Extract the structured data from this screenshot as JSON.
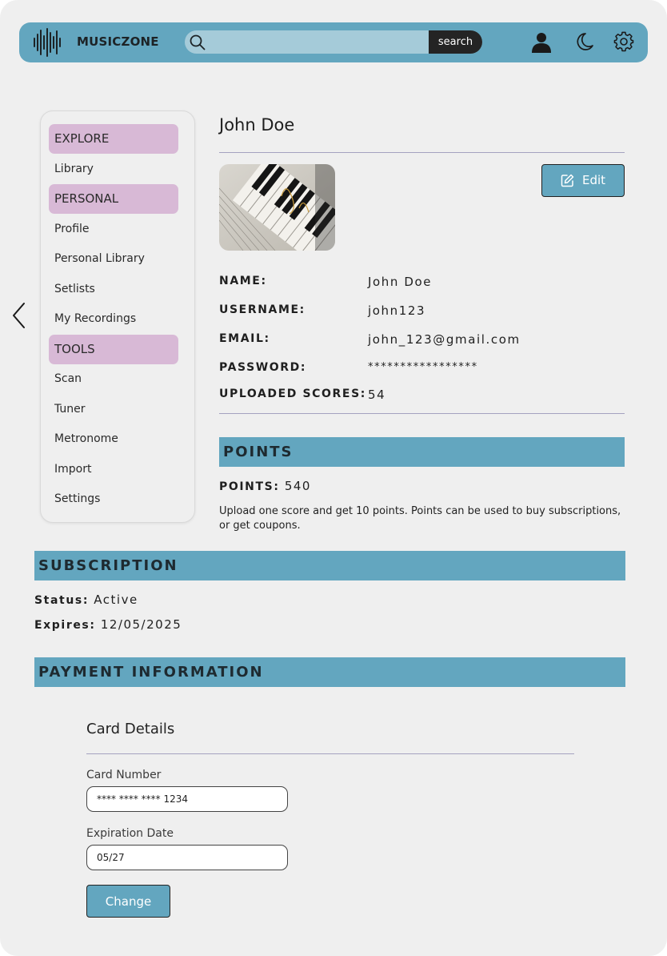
{
  "header": {
    "brand": "MUSICZONE",
    "search": {
      "placeholder": "",
      "value": "",
      "button_label": "search"
    },
    "icons": [
      "sound-wave-logo-icon",
      "search-icon",
      "user-icon",
      "moon-icon",
      "gear-icon"
    ],
    "accent_color": "#63a6bf"
  },
  "sidebar": {
    "items": [
      {
        "label": "EXPLORE",
        "type": "section"
      },
      {
        "label": "Library",
        "type": "link"
      },
      {
        "label": "PERSONAL",
        "type": "section"
      },
      {
        "label": "Profile",
        "type": "link"
      },
      {
        "label": "Personal Library",
        "type": "link"
      },
      {
        "label": "Setlists",
        "type": "link"
      },
      {
        "label": "My Recordings",
        "type": "link"
      },
      {
        "label": "TOOLS",
        "type": "section"
      },
      {
        "label": "Scan",
        "type": "link"
      },
      {
        "label": "Tuner",
        "type": "link"
      },
      {
        "label": "Metronome",
        "type": "link"
      },
      {
        "label": "Import",
        "type": "link"
      },
      {
        "label": "Settings",
        "type": "link"
      }
    ],
    "section_color": "#d8b9d6"
  },
  "profile": {
    "name": "John Doe",
    "edit_label": "Edit",
    "fields": [
      {
        "label": "NAME:",
        "value": "John Doe"
      },
      {
        "label": "USERNAME:",
        "value": "john123"
      },
      {
        "label": "EMAIL:",
        "value": "john_123@gmail.com"
      },
      {
        "label": "PASSWORD:",
        "value": "*****************"
      },
      {
        "label": "UPLOADED SCORES:",
        "value": "54"
      }
    ]
  },
  "points": {
    "title": "POINTS",
    "label": "POINTS:",
    "value": "540",
    "description": "Upload one score and get 10 points. Points can be used to buy subscriptions, or get coupons."
  },
  "subscription": {
    "title": "SUBSCRIPTION",
    "status_label": "Status:",
    "status_value": "Active",
    "expires_label": "Expires:",
    "expires_value": "12/05/2025"
  },
  "payment": {
    "title": "PAYMENT INFORMATION",
    "card_title": "Card Details",
    "card_number_label": "Card Number",
    "card_number_value": "**** **** **** 1234",
    "expiration_label": "Expiration Date",
    "expiration_value": "05/27",
    "change_label": "Change"
  }
}
